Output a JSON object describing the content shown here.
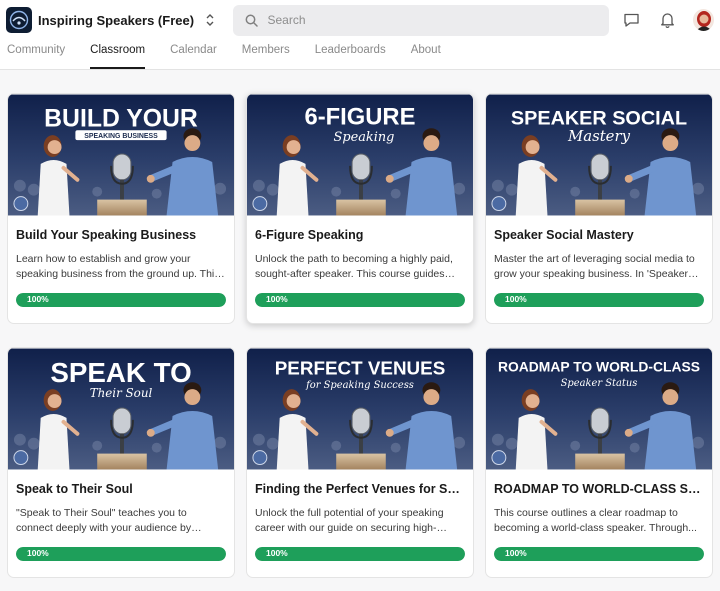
{
  "header": {
    "group_name": "Inspiring Speakers (Free)",
    "search_placeholder": "Search"
  },
  "tabs": [
    {
      "label": "Community",
      "active": false
    },
    {
      "label": "Classroom",
      "active": true
    },
    {
      "label": "Calendar",
      "active": false
    },
    {
      "label": "Members",
      "active": false
    },
    {
      "label": "Leaderboards",
      "active": false
    },
    {
      "label": "About",
      "active": false
    }
  ],
  "colors": {
    "progress": "#1e9f5a",
    "banner_bg": "#1b2b4e"
  },
  "courses": [
    {
      "title": "Build Your Speaking Business",
      "description": "Learn how to establish and grow your speaking business from the ground up. This course guides you...",
      "progress_label": "100%",
      "progress": 100,
      "banner_text": "BUILD YOUR",
      "banner_sub": "SPEAKING BUSINESS"
    },
    {
      "title": "6-Figure Speaking",
      "description": "Unlock the path to becoming a highly paid, sought-after speaker. This course guides you...",
      "progress_label": "100%",
      "progress": 100,
      "banner_text": "6-FIGURE",
      "banner_sub": "Speaking"
    },
    {
      "title": "Speaker Social Mastery",
      "description": "Master the art of leveraging social media to grow your speaking business. In 'Speaker Social Mastery'...",
      "progress_label": "100%",
      "progress": 100,
      "banner_text": "SPEAKER SOCIAL",
      "banner_sub": "Mastery"
    },
    {
      "title": "Speak to Their Soul",
      "description": "\"Speak to Their Soul\" teaches you to connect deeply with your audience by understanding...",
      "progress_label": "100%",
      "progress": 100,
      "banner_text": "SPEAK TO",
      "banner_sub": "Their Soul"
    },
    {
      "title": "Finding the Perfect Venues for Speaking Success",
      "description": "Unlock the full potential of your speaking career with our guide on securing high-profile venues...",
      "progress_label": "100%",
      "progress": 100,
      "banner_text": "PERFECT VENUES",
      "banner_sub": "for Speaking Success"
    },
    {
      "title": "ROADMAP TO WORLD-CLASS SPEAKER STATUS",
      "description": "This course outlines a clear roadmap to becoming a world-class speaker. Through...",
      "progress_label": "100%",
      "progress": 100,
      "banner_text": "ROADMAP TO WORLD-CLASS",
      "banner_sub": "Speaker Status"
    }
  ]
}
